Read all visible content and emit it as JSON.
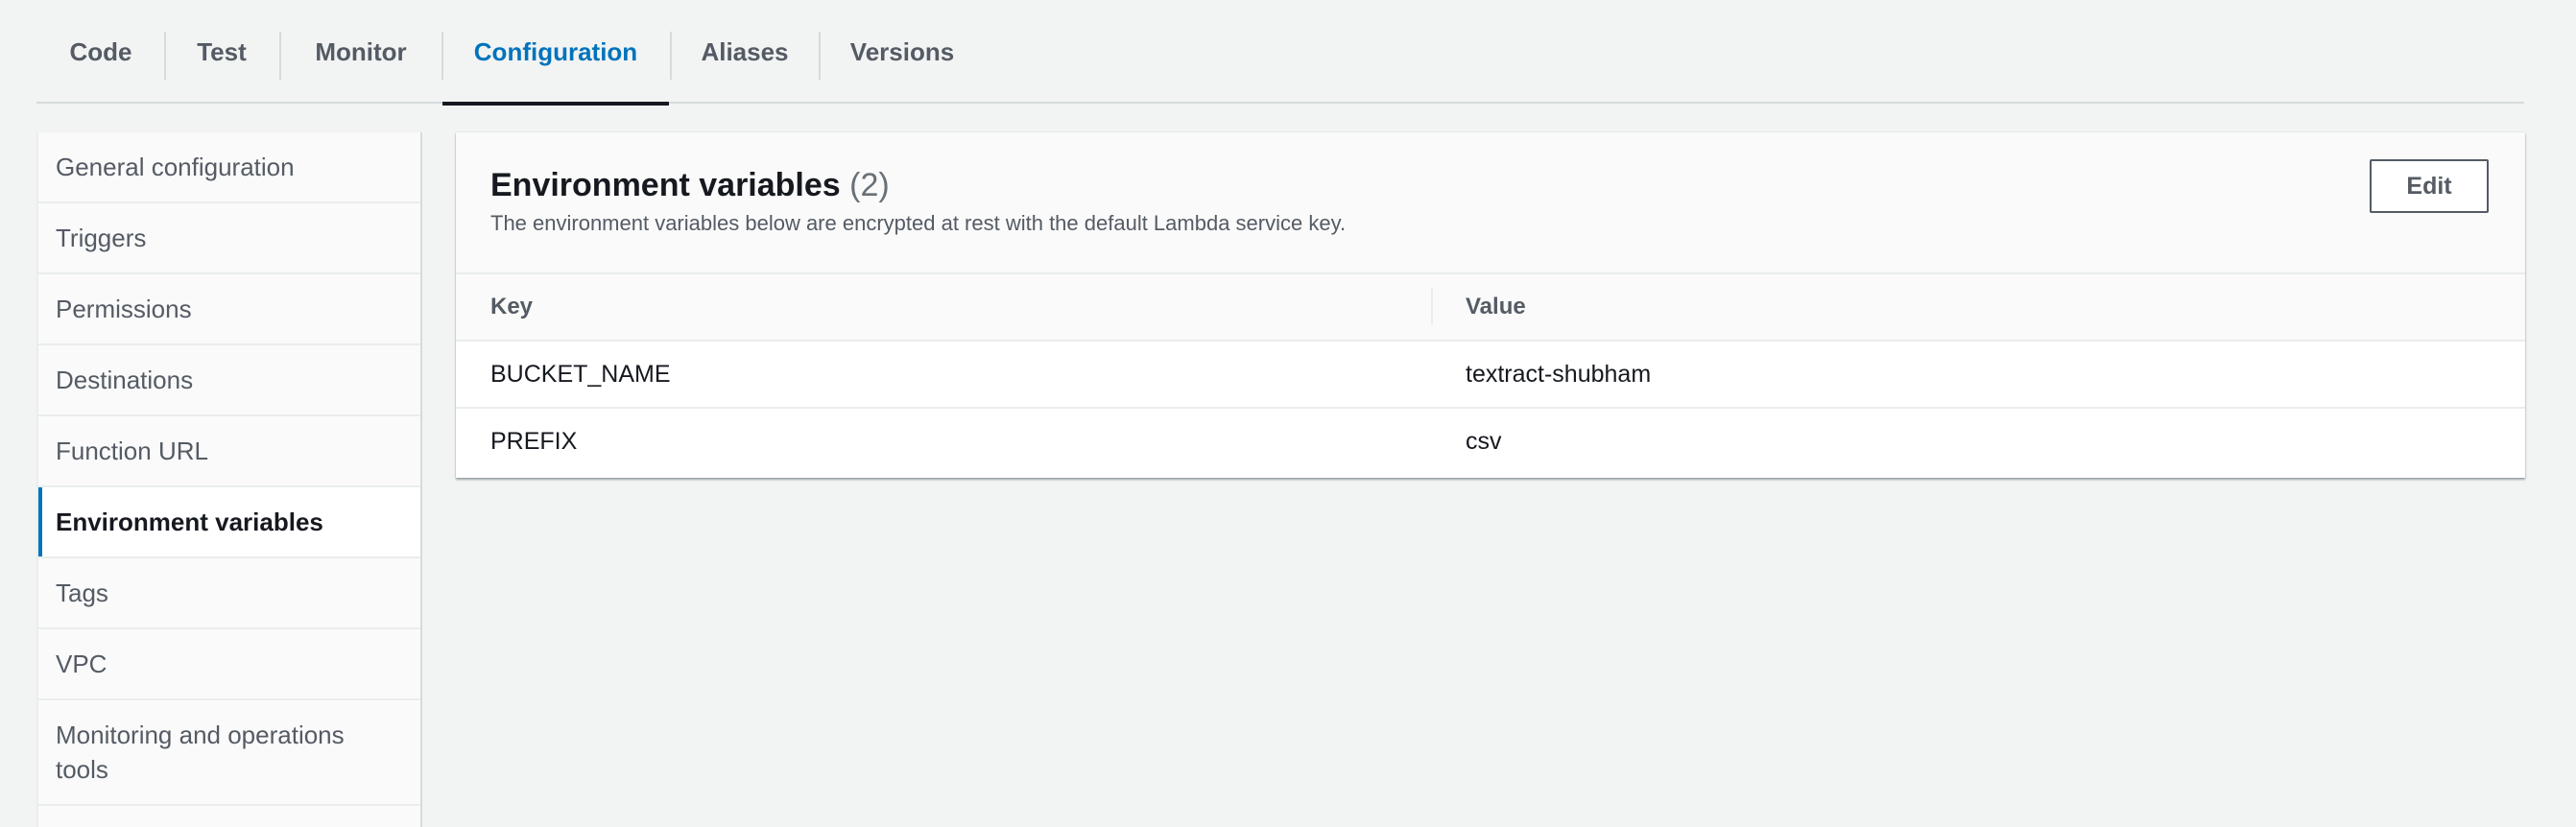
{
  "tabs": [
    {
      "label": "Code",
      "active": false
    },
    {
      "label": "Test",
      "active": false
    },
    {
      "label": "Monitor",
      "active": false
    },
    {
      "label": "Configuration",
      "active": true
    },
    {
      "label": "Aliases",
      "active": false
    },
    {
      "label": "Versions",
      "active": false
    }
  ],
  "sidebar": {
    "items": [
      {
        "label": "General configuration",
        "active": false
      },
      {
        "label": "Triggers",
        "active": false
      },
      {
        "label": "Permissions",
        "active": false
      },
      {
        "label": "Destinations",
        "active": false
      },
      {
        "label": "Function URL",
        "active": false
      },
      {
        "label": "Environment variables",
        "active": true
      },
      {
        "label": "Tags",
        "active": false
      },
      {
        "label": "VPC",
        "active": false
      },
      {
        "label": "Monitoring and operations tools",
        "active": false
      }
    ]
  },
  "panel": {
    "title": "Environment variables",
    "count": "(2)",
    "description": "The environment variables below are encrypted at rest with the default Lambda service key.",
    "edit_label": "Edit",
    "columns": [
      "Key",
      "Value"
    ],
    "rows": [
      {
        "key": "BUCKET_NAME",
        "value": "textract-shubham"
      },
      {
        "key": "PREFIX",
        "value": "csv"
      }
    ]
  },
  "colors": {
    "accent": "#0073bb",
    "background": "#f2f3f3",
    "text": "#16191f",
    "muted_text": "#545b64"
  }
}
